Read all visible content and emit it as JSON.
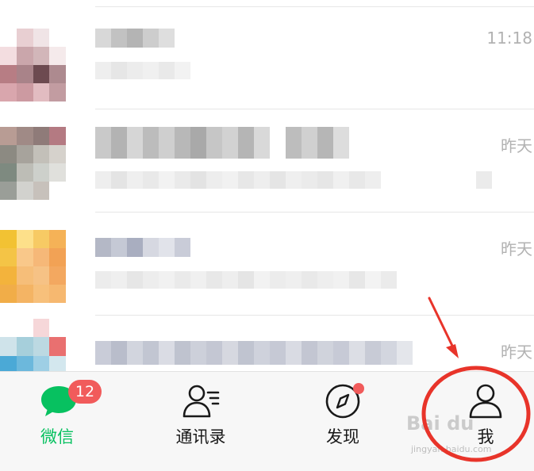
{
  "chats": [
    {
      "time": "11:18"
    },
    {
      "time": "昨天"
    },
    {
      "time": "昨天"
    },
    {
      "time": "昨天"
    }
  ],
  "tabbar": {
    "tabs": [
      {
        "label": "微信",
        "icon": "chat-bubble-icon",
        "badge": "12",
        "active": true
      },
      {
        "label": "通讯录",
        "icon": "contacts-icon"
      },
      {
        "label": "发现",
        "icon": "compass-icon"
      },
      {
        "label": "我",
        "icon": "person-icon"
      }
    ]
  },
  "colors": {
    "accent": "#07c160",
    "badge": "#f15b5b",
    "annotation": "#e8342a"
  },
  "watermark": {
    "main": "Bai du",
    "sub": "jingyan.baidu.com"
  }
}
